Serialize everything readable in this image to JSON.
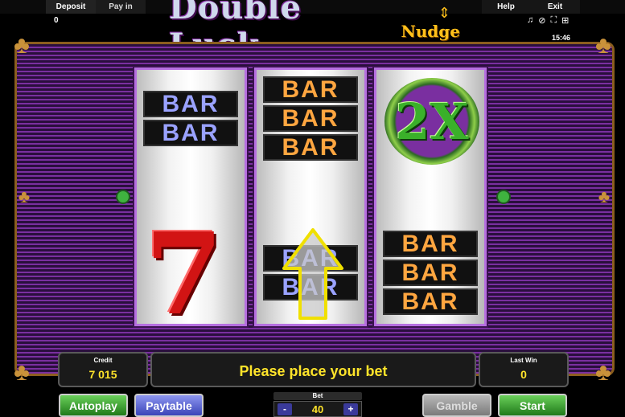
{
  "topbar": {
    "deposit_label": "Deposit",
    "payin_label": "Pay in",
    "help_label": "Help",
    "exit_label": "Exit",
    "balance": "0",
    "clock": "15:46",
    "icons": [
      "music-note-icon",
      "sound-off-icon",
      "fullscreen-icon",
      "settings-grid-icon"
    ]
  },
  "logo": {
    "main": "Double Luck",
    "sub": "Nudge"
  },
  "reels": {
    "reel1": {
      "top": [
        "BAR",
        "BAR"
      ],
      "bottom_symbol": "7"
    },
    "reel2": {
      "top": [
        "BAR",
        "BAR",
        "BAR"
      ],
      "bottom": [
        "BAR",
        "BAR"
      ]
    },
    "reel3": {
      "top_symbol": "2X",
      "bottom": [
        "BAR",
        "BAR",
        "BAR"
      ]
    }
  },
  "panel": {
    "credit_label": "Credit",
    "credit_value": "7 015",
    "message": "Please place your bet",
    "lastwin_label": "Last Win",
    "lastwin_value": "0"
  },
  "buttons": {
    "autoplay": "Autoplay",
    "paytable": "Paytable",
    "gamble": "Gamble",
    "start": "Start"
  },
  "bet": {
    "label": "Bet",
    "value": "40",
    "minus": "-",
    "plus": "+"
  },
  "colors": {
    "accent_yellow": "#ffe42a",
    "frame_purple": "#7a2fa0",
    "gold": "#c9923a"
  }
}
